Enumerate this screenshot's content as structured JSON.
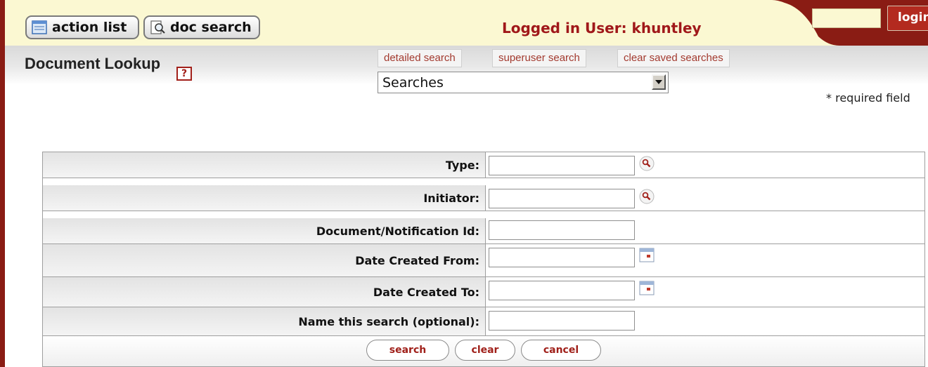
{
  "topbar": {
    "action_list_label": "action list",
    "doc_search_label": "doc search",
    "logged_in_text": "Logged in User: khuntley",
    "login_label": "login"
  },
  "header": {
    "title": "Document Lookup",
    "help_label": "?",
    "links": [
      "detailed search",
      "superuser search",
      "clear saved searches"
    ],
    "searches_select_value": "Searches",
    "required_note": "* required field"
  },
  "form": {
    "rows": [
      {
        "label": "Type:",
        "value": "",
        "icon": "lookup-icon"
      },
      {
        "label": "Initiator:",
        "value": "",
        "icon": "lookup-icon"
      },
      {
        "label": "Document/Notification Id:",
        "value": "",
        "icon": ""
      },
      {
        "label": "Date Created From:",
        "value": "",
        "icon": "calendar-icon"
      },
      {
        "label": "Date Created To:",
        "value": "",
        "icon": "calendar-icon"
      },
      {
        "label": "Name this search (optional):",
        "value": "",
        "icon": ""
      }
    ],
    "buttons": {
      "search": "search",
      "clear": "clear",
      "cancel": "cancel"
    }
  },
  "colors": {
    "brand_red": "#a0181a",
    "topbar_bg": "#fbf8d2",
    "login_bg": "#b32a1f"
  }
}
